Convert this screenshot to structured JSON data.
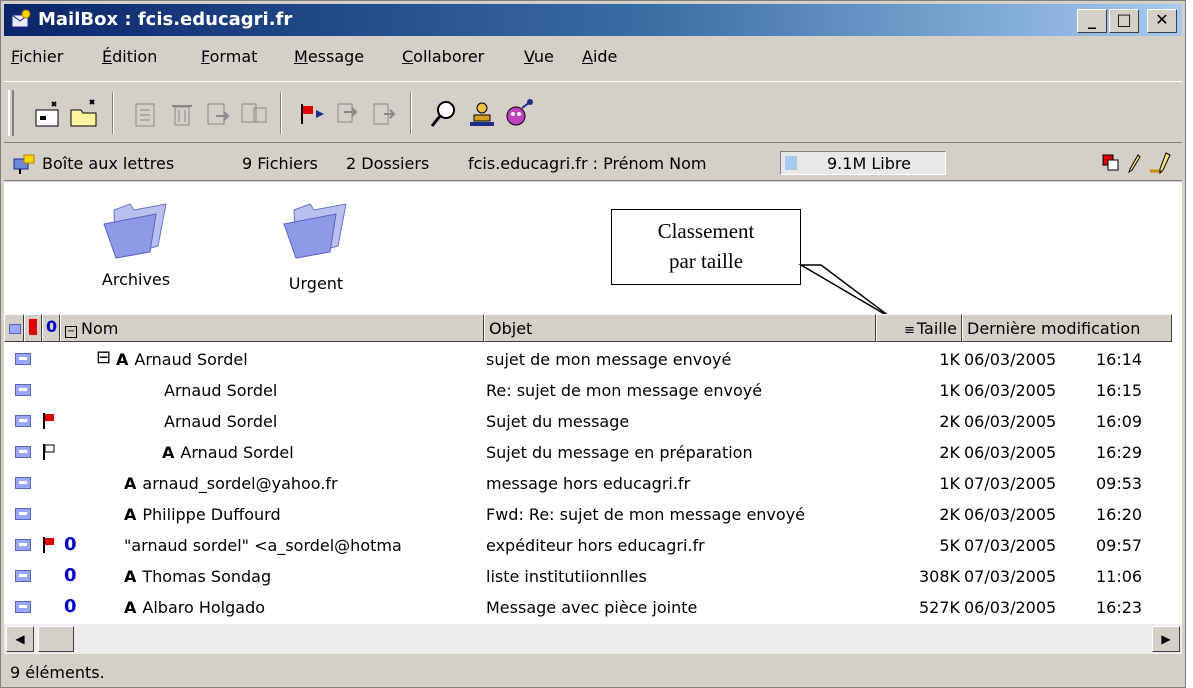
{
  "window": {
    "title": "MailBox : fcis.educagri.fr",
    "min_label": "_",
    "max_label": "□",
    "close_label": "✕"
  },
  "menu": {
    "items": [
      "Fichier",
      "Édition",
      "Format",
      "Message",
      "Collaborer",
      "Vue",
      "Aide"
    ]
  },
  "info": {
    "mailbox_label": "Boîte aux lettres",
    "files": "9 Fichiers",
    "folders": "2 Dossiers",
    "account": "fcis.educagri.fr : Prénom Nom",
    "free_space": "9.1M Libre"
  },
  "folders": [
    {
      "name": "Archives"
    },
    {
      "name": "Urgent"
    }
  ],
  "callout": {
    "line1": "Classement",
    "line2": "par taille"
  },
  "columns": {
    "name": "Nom",
    "subject": "Objet",
    "size": "Taille",
    "modified": "Dernière modification"
  },
  "messages": [
    {
      "name": "Arnaud Sordel",
      "a": "A",
      "subject": "sujet de mon message envoyé",
      "size": "1K",
      "date": "06/03/2005",
      "time": "16:14",
      "flag": "",
      "attachment": false,
      "tree": "⊟"
    },
    {
      "name": "Arnaud Sordel",
      "a": "",
      "subject": "Re: sujet de mon message envoyé",
      "size": "1K",
      "date": "06/03/2005",
      "time": "16:15",
      "flag": "",
      "attachment": false,
      "tree": ""
    },
    {
      "name": "Arnaud Sordel",
      "a": "",
      "subject": "Sujet du message",
      "size": "2K",
      "date": "06/03/2005",
      "time": "16:09",
      "flag": "red",
      "attachment": false,
      "tree": ""
    },
    {
      "name": "Arnaud Sordel",
      "a": "A",
      "subject": "Sujet du message en préparation",
      "size": "2K",
      "date": "06/03/2005",
      "time": "16:29",
      "flag": "outline",
      "attachment": false,
      "tree": ""
    },
    {
      "name": "arnaud_sordel@yahoo.fr",
      "a": "A",
      "subject": "message hors educagri.fr",
      "size": "1K",
      "date": "07/03/2005",
      "time": "09:53",
      "flag": "",
      "attachment": false,
      "tree": ""
    },
    {
      "name": "Philippe Duffourd",
      "a": "A",
      "subject": "Fwd: Re: sujet de mon message envoyé",
      "size": "2K",
      "date": "06/03/2005",
      "time": "16:20",
      "flag": "",
      "attachment": false,
      "tree": ""
    },
    {
      "name": "\"arnaud sordel\" <a_sordel@hotma",
      "a": "",
      "subject": "expéditeur hors educagri.fr",
      "size": "5K",
      "date": "07/03/2005",
      "time": "09:57",
      "flag": "red",
      "attachment": true,
      "tree": ""
    },
    {
      "name": "Thomas Sondag",
      "a": "A",
      "subject": "liste institutiionnlles",
      "size": "308K",
      "date": "07/03/2005",
      "time": "11:06",
      "flag": "",
      "attachment": true,
      "tree": ""
    },
    {
      "name": "Albaro Holgado",
      "a": "A",
      "subject": "Message avec pièce jointe",
      "size": "527K",
      "date": "06/03/2005",
      "time": "16:23",
      "flag": "",
      "attachment": true,
      "tree": ""
    }
  ],
  "status": {
    "text": "9 éléments."
  },
  "colors": {
    "title_start": "#0a246a",
    "title_end": "#a6caf0",
    "flag_red": "#e00000",
    "attachment_blue": "#0000cc"
  },
  "icons": [
    "app-icon",
    "new-message-icon",
    "new-folder-icon",
    "reply-icon",
    "delete-icon",
    "move-icon",
    "copy-icon",
    "flag-icon",
    "print-icon",
    "forward-icon",
    "search-icon",
    "user-icon",
    "network-icon",
    "mailbox-icon",
    "cascade-icon",
    "pencil-icon",
    "key-icon",
    "folder-icon",
    "envelope-icon",
    "paperclip-icon"
  ]
}
